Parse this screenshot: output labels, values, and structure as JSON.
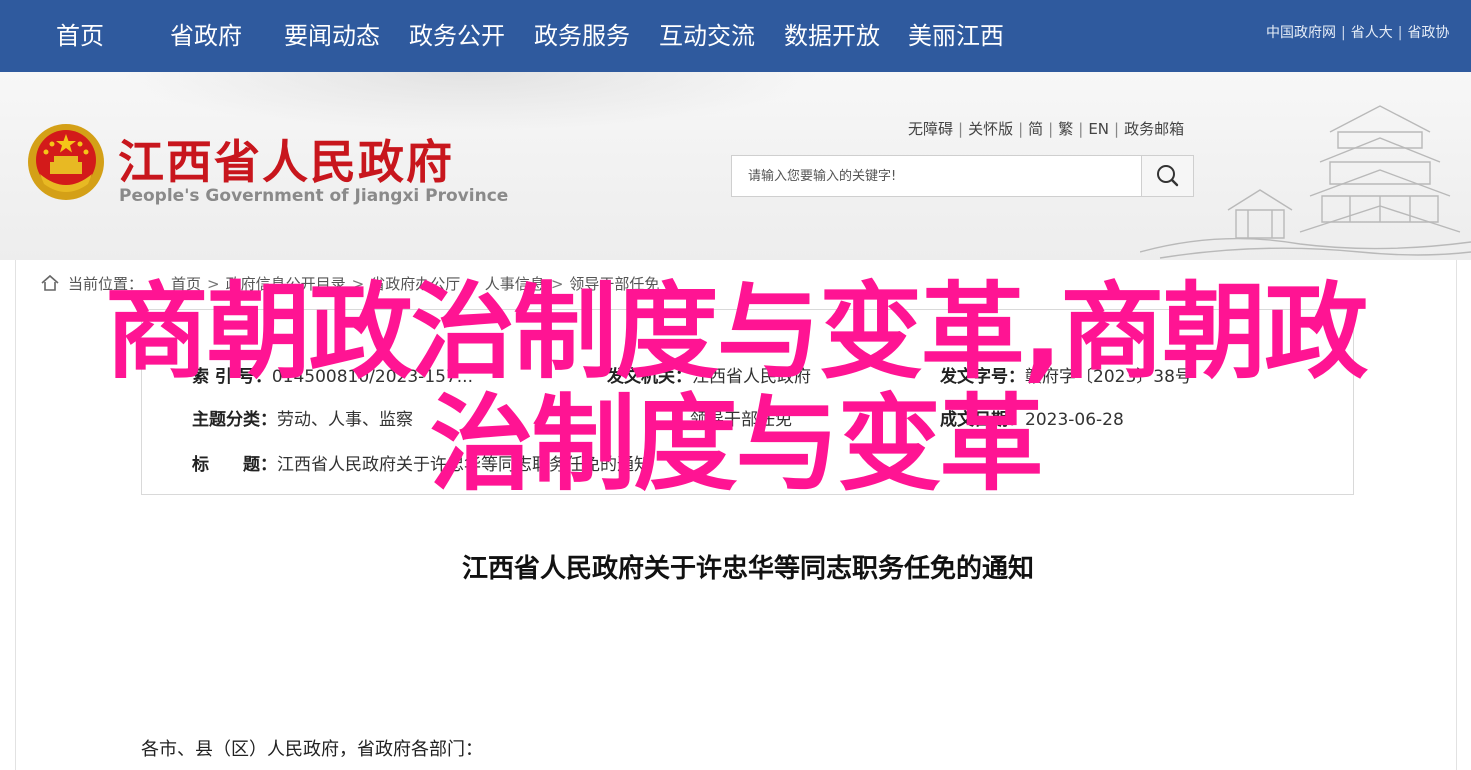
{
  "nav": {
    "items": [
      "首页",
      "省政府",
      "要闻动态",
      "政务公开",
      "政务服务",
      "互动交流",
      "数据开放",
      "美丽江西"
    ],
    "links": [
      "中国政府网",
      "省人大",
      "省政协"
    ]
  },
  "header": {
    "title_cn": "江西省人民政府",
    "title_en": "People's Government of Jiangxi Province",
    "utility": [
      "无障碍",
      "关怀版",
      "简",
      "繁",
      "EN",
      "政务邮箱"
    ],
    "search_placeholder": "请输入您要输入的关键字!"
  },
  "breadcrumb": {
    "prefix": "当前位置：",
    "items": [
      "首页",
      "政府信息公开目录",
      "省政府办公厅",
      "人事信息",
      "领导干部任免"
    ]
  },
  "info": {
    "index_label": "索 引 号：",
    "index_value": "014500810/2023-157...",
    "issuer_label": "发文机关：",
    "issuer_value": "江西省人民政府",
    "docnum_label": "发文字号：",
    "docnum_value": "赣府字〔2023〕38号",
    "category_label": "主题分类：",
    "category_value": "劳动、人事、监察",
    "category2_value": "领导干部任免",
    "date_label": "成文日期：",
    "date_value": "2023-06-28",
    "title_label": "标　　题：",
    "title_value": "江西省人民政府关于许忠华等同志职务任免的通知"
  },
  "overlay": {
    "line1": "商朝政治制度与变革,商朝政",
    "line2": "治制度与变革"
  },
  "document": {
    "title": "江西省人民政府关于许忠华等同志职务任免的通知",
    "salutation": "各市、县（区）人民政府，省政府各部门："
  },
  "colors": {
    "nav_bg": "#2f5a9e",
    "logo_red": "#c8161d",
    "overlay_pink": "#ff1493"
  }
}
